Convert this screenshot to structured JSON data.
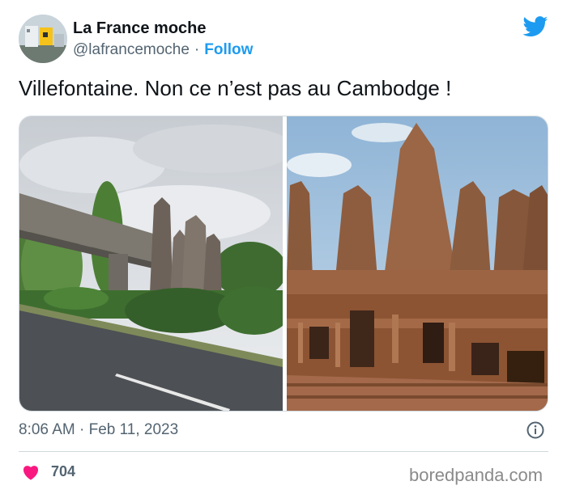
{
  "author": {
    "display_name": "La France moche",
    "handle": "@lafrancemoche",
    "separator": "·",
    "follow_label": "Follow",
    "avatar": "profile-photo"
  },
  "tweet": {
    "text": "Villefontaine. Non ce n’est pas au Cambodge !",
    "timestamp": "8:06 AM · Feb 11, 2023",
    "likes": "704"
  },
  "media": [
    {
      "name": "villefontaine-photo",
      "description": "concrete walkway and temple-like towers beside a road"
    },
    {
      "name": "bayon-temple-photo",
      "description": "sandstone towers of an ancient temple"
    }
  ],
  "icons": {
    "brand": "twitter-bird-icon",
    "info": "info-icon",
    "like": "heart-icon"
  },
  "colors": {
    "accent": "#1d9bf0",
    "heart": "#f91880",
    "secondary_text": "#536471",
    "divider": "#cfd9de"
  },
  "watermark": "boredpanda.com"
}
